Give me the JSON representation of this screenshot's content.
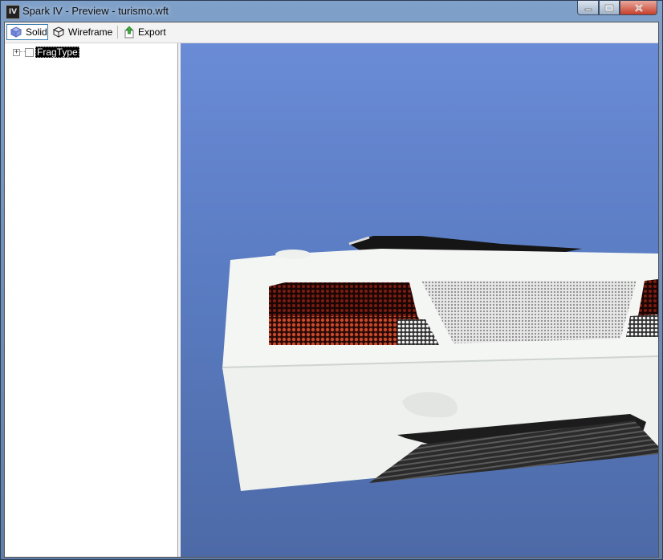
{
  "window": {
    "title": "Spark IV - Preview - turismo.wft",
    "app_icon_text": "IV"
  },
  "toolbar": {
    "solid_label": "Solid",
    "wireframe_label": "Wireframe",
    "export_label": "Export"
  },
  "tree": {
    "items": [
      {
        "label": "FragType",
        "expander": "+"
      }
    ]
  },
  "viewport": {
    "content": "3D preview of car model (rear view)"
  },
  "colors": {
    "viewport_top": "#6a8bd6",
    "viewport_bottom": "#4d6aa7",
    "car_body": "#f4f6f4",
    "tail_light": "#b23a22"
  }
}
